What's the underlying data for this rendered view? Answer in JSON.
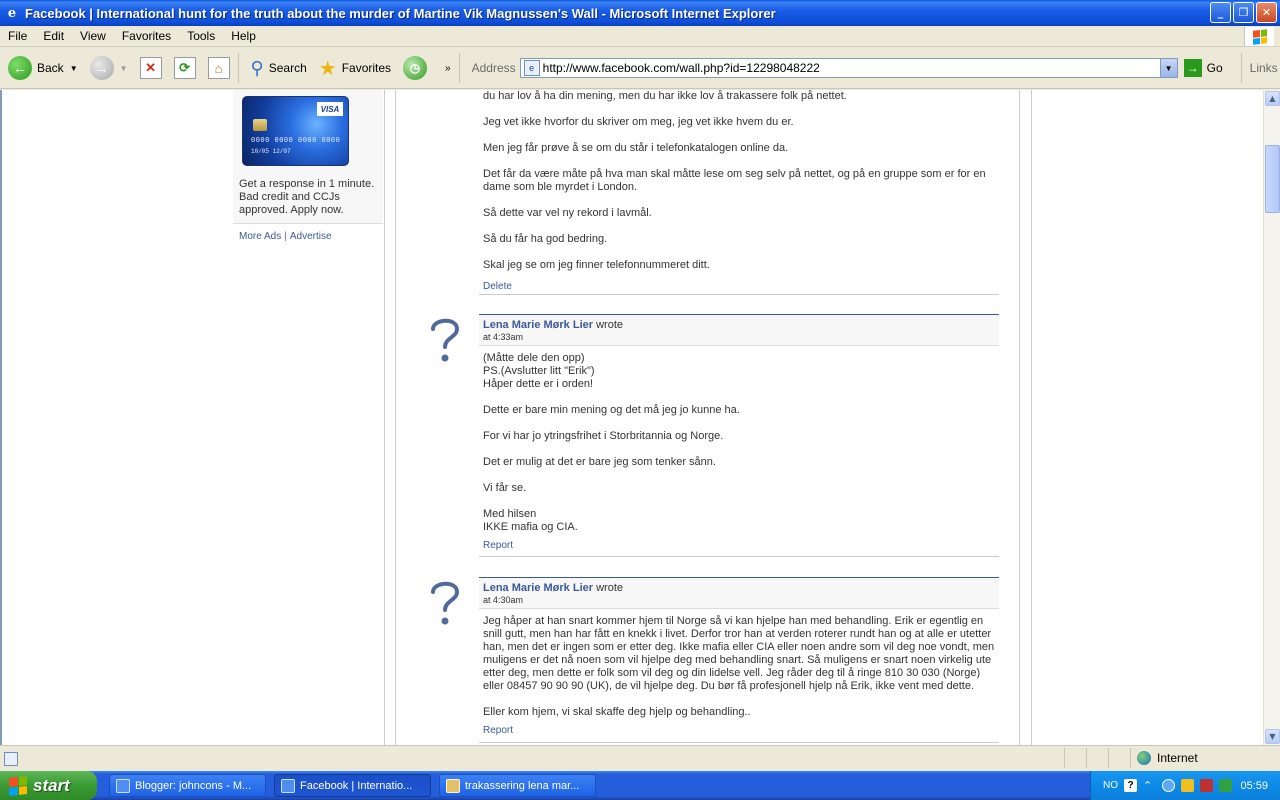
{
  "window": {
    "title": "Facebook | International hunt for the truth about the murder of Martine Vik Magnussen's Wall - Microsoft Internet Explorer"
  },
  "menu": [
    "File",
    "Edit",
    "View",
    "Favorites",
    "Tools",
    "Help"
  ],
  "toolbar": {
    "back_label": "Back",
    "search_label": "Search",
    "favorites_label": "Favorites",
    "address_label": "Address",
    "url": "http://www.facebook.com/wall.php?id=12298048222",
    "go_label": "Go",
    "links_label": "Links"
  },
  "ad": {
    "card_brand": "VISA",
    "card_number": "0000 0000 0000 0000",
    "card_expiry": "10/05  12/07",
    "text": "Get a response in 1 minute. Bad credit and CCJs approved. Apply now.",
    "more_ads": "More Ads",
    "separator": "|",
    "advertise": "Advertise"
  },
  "wall": {
    "first_post_body": [
      "du har lov å ha din mening, men du har ikke lov å trakassere folk på nettet.",
      "Jeg vet ikke hvorfor du skriver om meg, jeg vet ikke hvem du er.",
      "Men jeg får prøve å se om du står i telefonkatalogen online da.",
      "Det får da være måte på hva man skal måtte lese om seg selv på nettet, og på en gruppe som er for en dame som ble myrdet i London.",
      "Så dette var vel ny rekord i lavmål.",
      "Så du får ha god bedring.",
      "Skal jeg se om jeg finner telefonnummeret ditt."
    ],
    "first_post_action": "Delete",
    "posts": [
      {
        "author": "Lena Marie Mørk Lier",
        "wrote": "wrote",
        "time": "at 4:33am",
        "body": "(Måtte dele den opp)\nPS.(Avslutter litt \"Erik\")\nHåper dette er i orden!\n\nDette er bare min mening og det må jeg jo kunne ha.\n\nFor vi har jo ytringsfrihet i Storbritannia og Norge.\n\nDet er mulig at det er bare jeg som tenker sånn.\n\nVi får se.\n\nMed hilsen\nIKKE mafia og CIA.",
        "action": "Report"
      },
      {
        "author": "Lena Marie Mørk Lier",
        "wrote": "wrote",
        "time": "at 4:30am",
        "body": "Jeg håper at han snart kommer hjem til Norge så vi kan hjelpe han med behandling. Erik er egentlig en snill gutt, men han har fått en knekk i livet. Derfor tror han at verden roterer rundt han og at alle er utetter han, men det er ingen som er etter deg. Ikke mafia eller CIA eller noen andre som vil deg noe vondt, men muligens er det nå noen som vil hjelpe deg med behandling snart. Så muligens er snart noen virkelig ute etter deg, men dette er folk som vil deg og din lidelse vell. Jeg råder deg til å ringe 810 30 030 (Norge) eller 08457 90 90 90 (UK), de vil hjelpe deg. Du bør få profesjonell hjelp nå Erik, ikke vent med dette.\n\nEller kom hjem, vi skal skaffe deg hjelp og behandling..",
        "action": "Report"
      }
    ]
  },
  "status": {
    "zone": "Internet"
  },
  "taskbar": {
    "start_label": "start",
    "tasks": [
      "Blogger: johncons - M...",
      "Facebook | Internatio...",
      "trakassering lena mar..."
    ],
    "language": "NO",
    "clock": "05:59"
  },
  "colors": {
    "facebook_blue": "#3b5998",
    "titlebar_blue": "#0a58e0",
    "taskbar_blue": "#245edb",
    "start_green": "#3a9a32"
  },
  "icons": [
    "ie-logo-icon",
    "minimize-icon",
    "restore-icon",
    "close-icon",
    "back-arrow-icon",
    "forward-arrow-icon",
    "stop-icon",
    "refresh-icon",
    "home-icon",
    "search-magnifier-icon",
    "favorites-star-icon",
    "history-icon",
    "page-icon",
    "go-arrow-icon",
    "question-mark-avatar-icon",
    "globe-icon",
    "windows-flag-icon"
  ]
}
